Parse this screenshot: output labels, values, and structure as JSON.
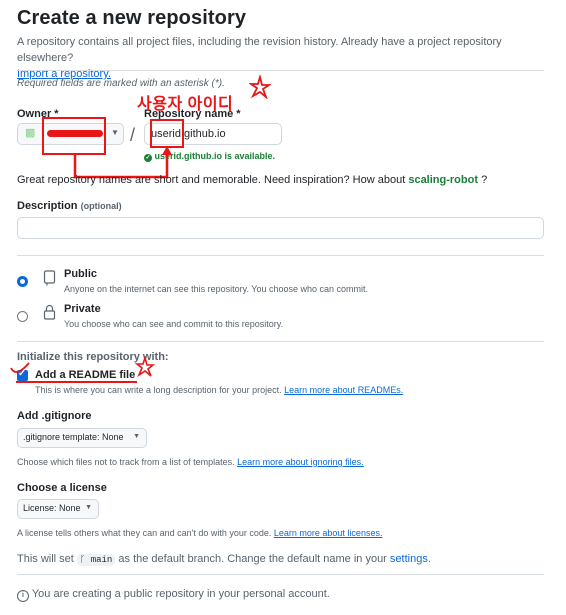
{
  "header": {
    "title": "Create a new repository",
    "description": "A repository contains all project files, including the revision history. Already have a project repository elsewhere?",
    "import_link": "Import a repository."
  },
  "form": {
    "required_note": "Required fields are marked with an asterisk (*).",
    "owner_label": "Owner *",
    "repo_label": "Repository name *",
    "repo_value": "userid.github.io",
    "availability": "userid.github.io is available.",
    "suggestion_text": "Great repository names are short and memorable. Need inspiration? How about",
    "suggestion_name": "scaling-robot",
    "suggestion_end": "?",
    "description_label": "Description",
    "description_optional": "(optional)",
    "description_value": ""
  },
  "visibility": {
    "public_title": "Public",
    "public_desc": "Anyone on the internet can see this repository. You choose who can commit.",
    "public_selected": true,
    "private_title": "Private",
    "private_desc": "You choose who can see and commit to this repository."
  },
  "init": {
    "heading": "Initialize this repository with:",
    "readme_label": "Add a README file",
    "readme_checked": true,
    "readme_desc": "This is where you can write a long description for your project.",
    "readme_link": "Learn more about READMEs."
  },
  "gitignore": {
    "label": "Add .gitignore",
    "select": ".gitignore template: None",
    "help": "Choose which files not to track from a list of templates.",
    "help_link": "Learn more about ignoring files."
  },
  "license": {
    "label": "Choose a license",
    "select": "License: None",
    "help": "A license tells others what they can and can't do with your code.",
    "help_link": "Learn more about licenses."
  },
  "branch": {
    "prefix": "This will set",
    "name": "main",
    "middle": "as the default branch. Change the default name in your",
    "settings_link": "settings",
    "suffix": "."
  },
  "notice": {
    "text": "You are creating a public repository in your personal account."
  },
  "annotation": {
    "korean_label": "사용자 아이디",
    "color": "#e81616"
  },
  "colors": {
    "accent": "#0969da",
    "success": "#1a7f37",
    "annotation": "#e81616"
  }
}
